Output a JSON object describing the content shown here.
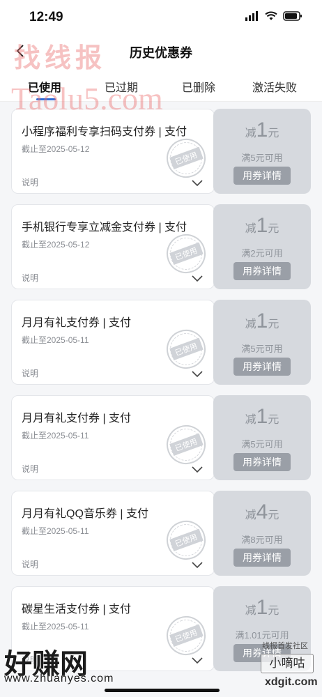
{
  "status": {
    "time": "12:49"
  },
  "nav": {
    "title": "历史优惠券"
  },
  "tabs": [
    {
      "label": "已使用",
      "active": true
    },
    {
      "label": "已过期",
      "active": false
    },
    {
      "label": "已删除",
      "active": false
    },
    {
      "label": "激活失败",
      "active": false
    }
  ],
  "coupons": [
    {
      "title": "小程序福利专享扫码支付券 | 支付",
      "date": "截止至2025-05-12",
      "desc": "说明",
      "stamp": "已使用",
      "prefix": "减",
      "amount": "1",
      "unit": "元",
      "condition": "满5元可用",
      "button": "用券详情"
    },
    {
      "title": "手机银行专享立减金支付券 | 支付",
      "date": "截止至2025-05-12",
      "desc": "说明",
      "stamp": "已使用",
      "prefix": "减",
      "amount": "1",
      "unit": "元",
      "condition": "满2元可用",
      "button": "用券详情"
    },
    {
      "title": "月月有礼支付券 | 支付",
      "date": "截止至2025-05-11",
      "desc": "说明",
      "stamp": "已使用",
      "prefix": "减",
      "amount": "1",
      "unit": "元",
      "condition": "满5元可用",
      "button": "用券详情"
    },
    {
      "title": "月月有礼支付券 | 支付",
      "date": "截止至2025-05-11",
      "desc": "说明",
      "stamp": "已使用",
      "prefix": "减",
      "amount": "1",
      "unit": "元",
      "condition": "满5元可用",
      "button": "用券详情"
    },
    {
      "title": "月月有礼QQ音乐券 | 支付",
      "date": "截止至2025-05-11",
      "desc": "说明",
      "stamp": "已使用",
      "prefix": "减",
      "amount": "4",
      "unit": "元",
      "condition": "满8元可用",
      "button": "用券详情"
    },
    {
      "title": "碳星生活支付券 | 支付",
      "date": "截止至2025-05-11",
      "desc": "说明",
      "stamp": "已使用",
      "prefix": "减",
      "amount": "1",
      "unit": "元",
      "condition": "满1.01元可用",
      "button": "用券详情"
    }
  ],
  "watermarks": {
    "top": "找线报",
    "mid": "Taolu5.com",
    "bottom_left": "好赚网",
    "bottom_left_url": "www.zhuanyes.com",
    "bottom_right_top": "线报首发社区",
    "bottom_right": "小嘀咕",
    "bottom_right_url": "xdgit.com"
  },
  "colors": {
    "accent": "#2f6bd8",
    "coupon_right_bg": "#d6d9de",
    "button_bg": "#9a9fa7"
  },
  "icons": {
    "back": "chevron-left-icon",
    "expand": "chevron-down-icon",
    "signal": "signal-icon",
    "wifi": "wifi-icon",
    "battery": "battery-icon"
  }
}
